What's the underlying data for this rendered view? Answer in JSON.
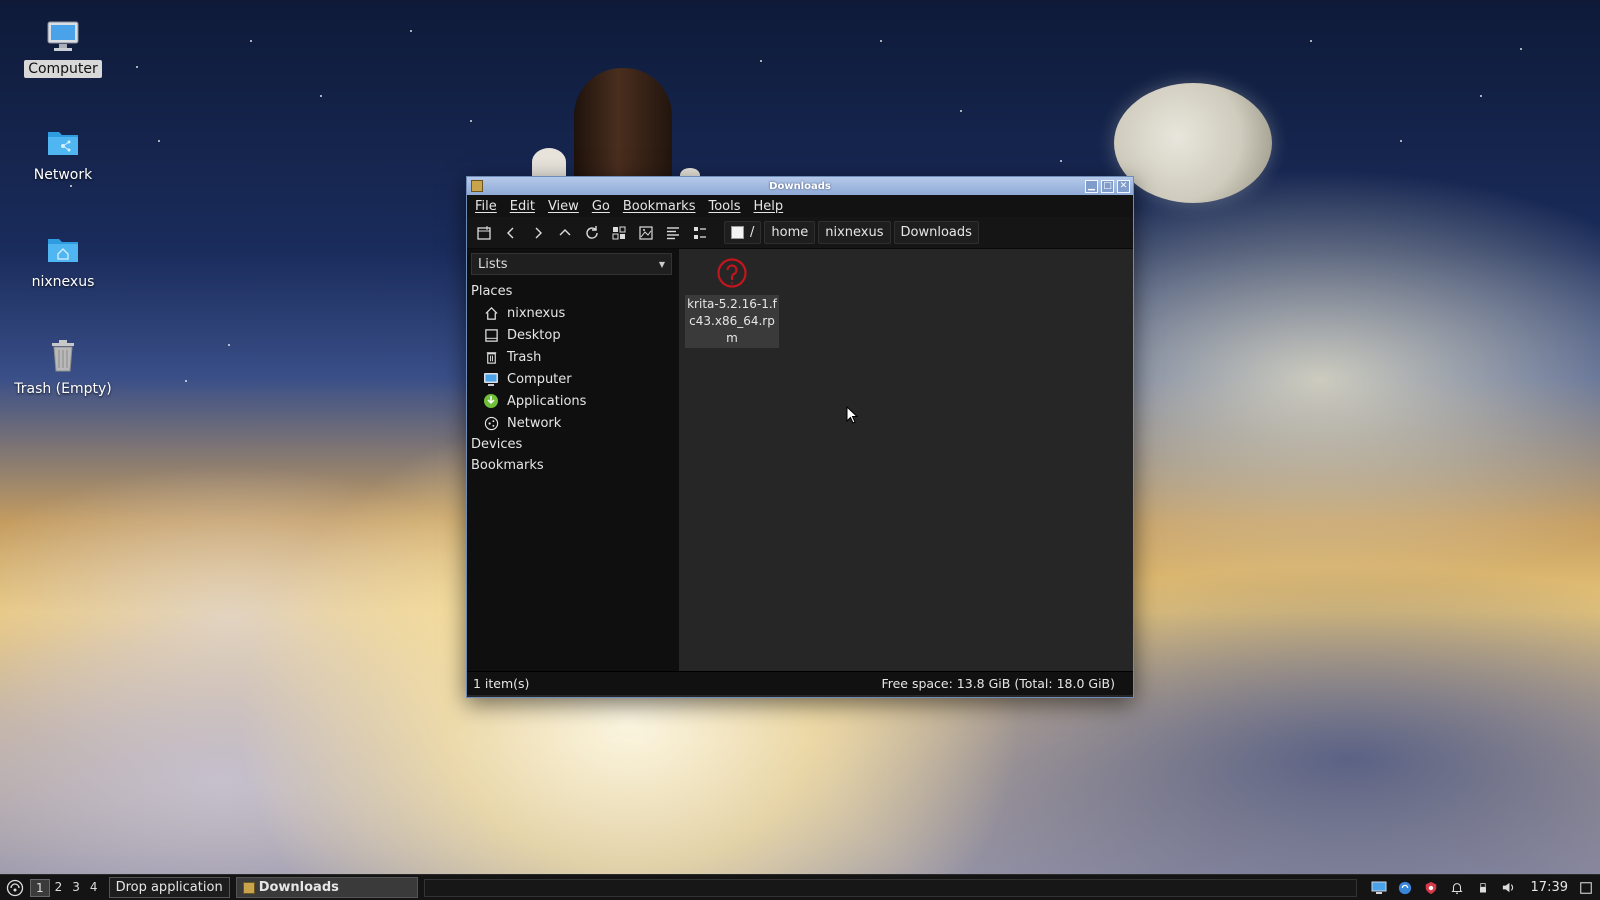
{
  "desktop": {
    "icons": [
      {
        "label": "Computer"
      },
      {
        "label": "Network"
      },
      {
        "label": "nixnexus"
      },
      {
        "label": "Trash (Empty)"
      }
    ]
  },
  "window": {
    "title": "Downloads",
    "menu": [
      "File",
      "Edit",
      "View",
      "Go",
      "Bookmarks",
      "Tools",
      "Help"
    ],
    "path": {
      "root": "/",
      "crumbs": [
        "home",
        "nixnexus",
        "Downloads"
      ]
    },
    "side": {
      "combo": "Lists",
      "places_header": "Places",
      "places": [
        {
          "label": "nixnexus",
          "icon": "home-icon"
        },
        {
          "label": "Desktop",
          "icon": "desktop-icon"
        },
        {
          "label": "Trash",
          "icon": "trash-icon"
        },
        {
          "label": "Computer",
          "icon": "computer-icon"
        },
        {
          "label": "Applications",
          "icon": "applications-icon"
        },
        {
          "label": "Network",
          "icon": "network-icon"
        }
      ],
      "devices_header": "Devices",
      "bookmarks_header": "Bookmarks"
    },
    "files": [
      {
        "name": "krita-5.2.16-1.fc43.x86_64.rpm",
        "icon": "rpm-package-icon"
      }
    ],
    "status": {
      "items": "1 item(s)",
      "free_space": "Free space: 13.8 GiB (Total: 18.0 GiB)"
    }
  },
  "taskbar": {
    "workspaces": [
      "1",
      "2",
      "3",
      "4"
    ],
    "drop_application": "Drop application",
    "task_label": "Downloads",
    "clock": "17:39"
  },
  "colors": {
    "titlebar": "#8eaad6",
    "window_bg": "#262626",
    "sidepane_bg": "#0f0f0f",
    "rpm_icon": "#c2161e"
  }
}
